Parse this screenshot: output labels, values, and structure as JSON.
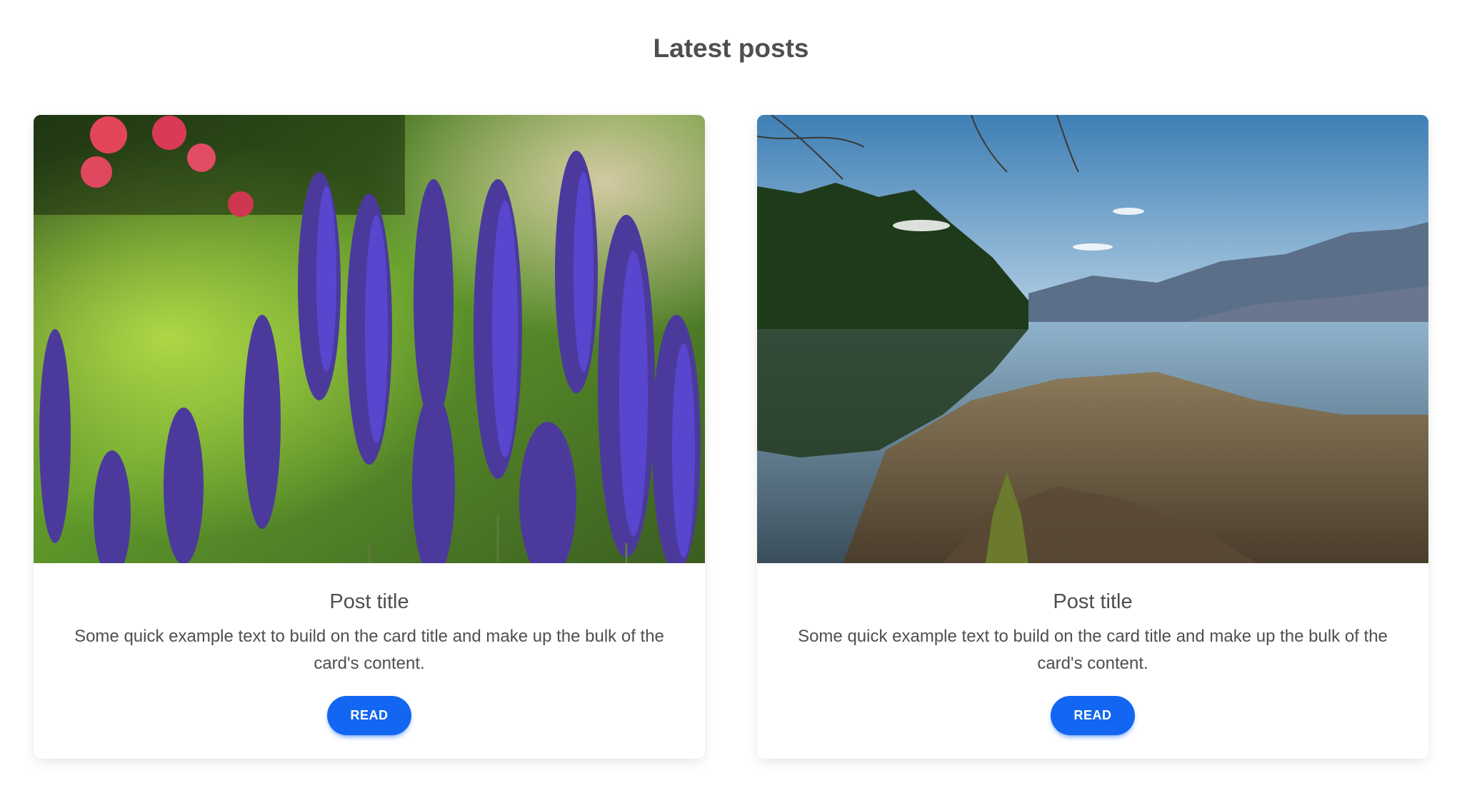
{
  "page": {
    "heading": "Latest posts"
  },
  "posts": [
    {
      "image": "lavender-flowers-photo",
      "title": "Post title",
      "text": "Some quick example text to build on the card title and make up the bulk of the card's content.",
      "button_label": "READ"
    },
    {
      "image": "mountain-lake-photo",
      "title": "Post title",
      "text": "Some quick example text to build on the card title and make up the bulk of the card's content.",
      "button_label": "READ"
    }
  ],
  "colors": {
    "primary": "#1266f1",
    "text": "#4f4f4f",
    "background": "#ffffff"
  }
}
